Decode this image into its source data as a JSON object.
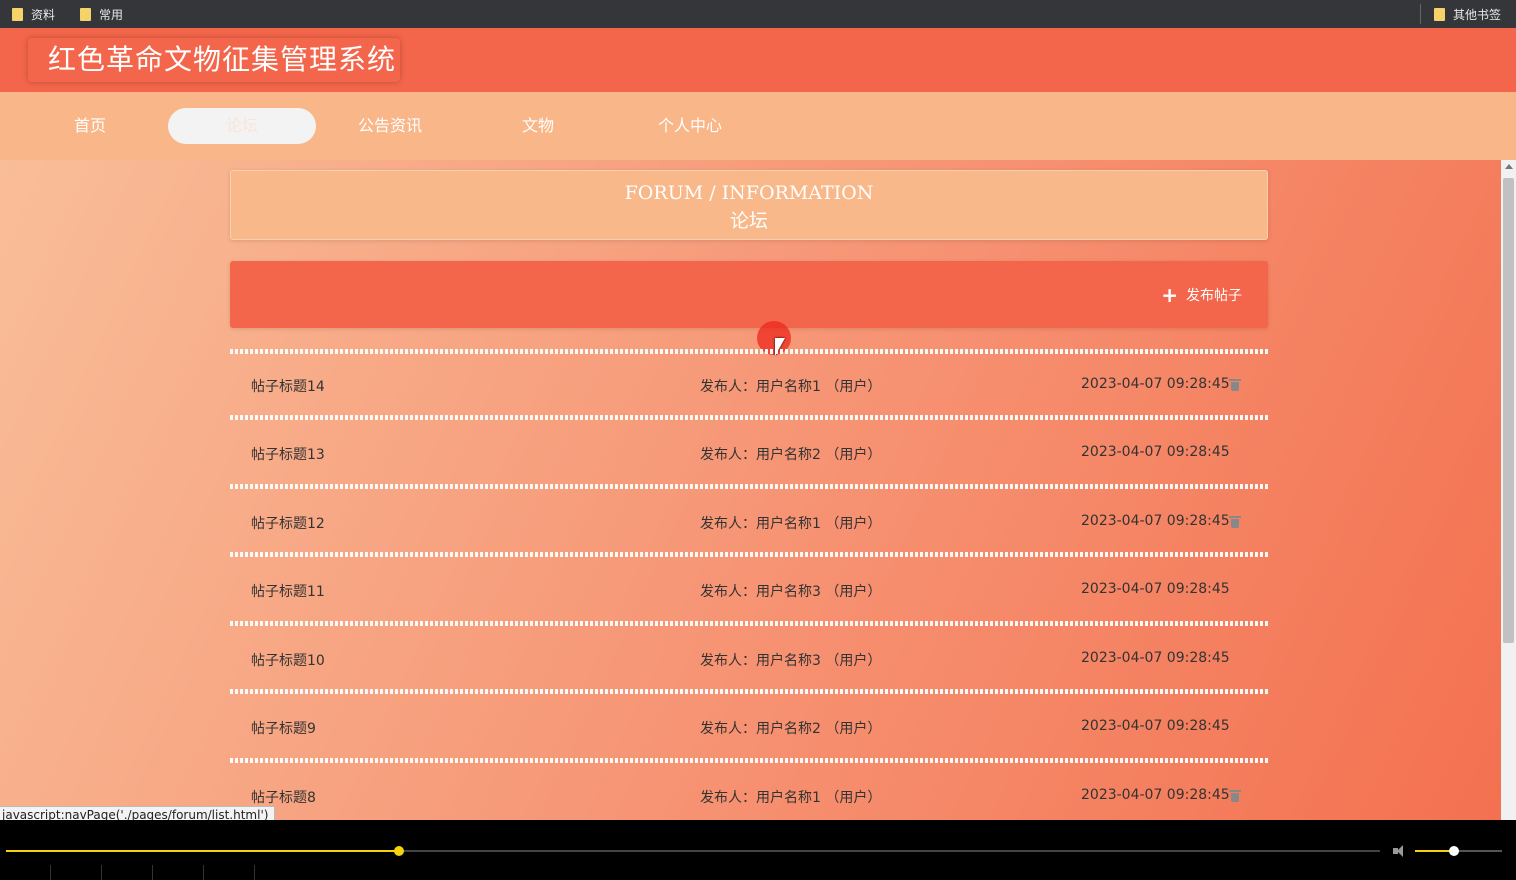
{
  "browser": {
    "bookmarks": [
      "资料",
      "常用"
    ],
    "other_bookmarks": "其他书签",
    "status_url": "javascript:navPage('./pages/forum/list.html')"
  },
  "site": {
    "title": "红色革命文物征集管理系统"
  },
  "nav": {
    "items": [
      "首页",
      "论坛",
      "公告资讯",
      "文物",
      "个人中心"
    ],
    "active": "论坛"
  },
  "banner": {
    "english": "FORUM / INFORMATION",
    "chinese": "论坛"
  },
  "actions": {
    "publish_label": "发布帖子",
    "publish_icon": "plus-icon"
  },
  "posts": [
    {
      "title": "帖子标题14",
      "author": "发布人：用户名称1 （用户）",
      "time": "2023-04-07 09:28:45",
      "deletable": true
    },
    {
      "title": "帖子标题13",
      "author": "发布人：用户名称2 （用户）",
      "time": "2023-04-07 09:28:45",
      "deletable": false
    },
    {
      "title": "帖子标题12",
      "author": "发布人：用户名称1 （用户）",
      "time": "2023-04-07 09:28:45",
      "deletable": true
    },
    {
      "title": "帖子标题11",
      "author": "发布人：用户名称3 （用户）",
      "time": "2023-04-07 09:28:45",
      "deletable": false
    },
    {
      "title": "帖子标题10",
      "author": "发布人：用户名称3 （用户）",
      "time": "2023-04-07 09:28:45",
      "deletable": false
    },
    {
      "title": "帖子标题9",
      "author": "发布人：用户名称2 （用户）",
      "time": "2023-04-07 09:28:45",
      "deletable": false
    },
    {
      "title": "帖子标题8",
      "author": "发布人：用户名称1 （用户）",
      "time": "2023-04-07 09:28:45",
      "deletable": true
    }
  ],
  "player": {
    "progress": 0.286,
    "volume": 0.45
  },
  "colors": {
    "header": "#f4664b",
    "nav": "#f9b688",
    "accent": "#f5d20a"
  }
}
